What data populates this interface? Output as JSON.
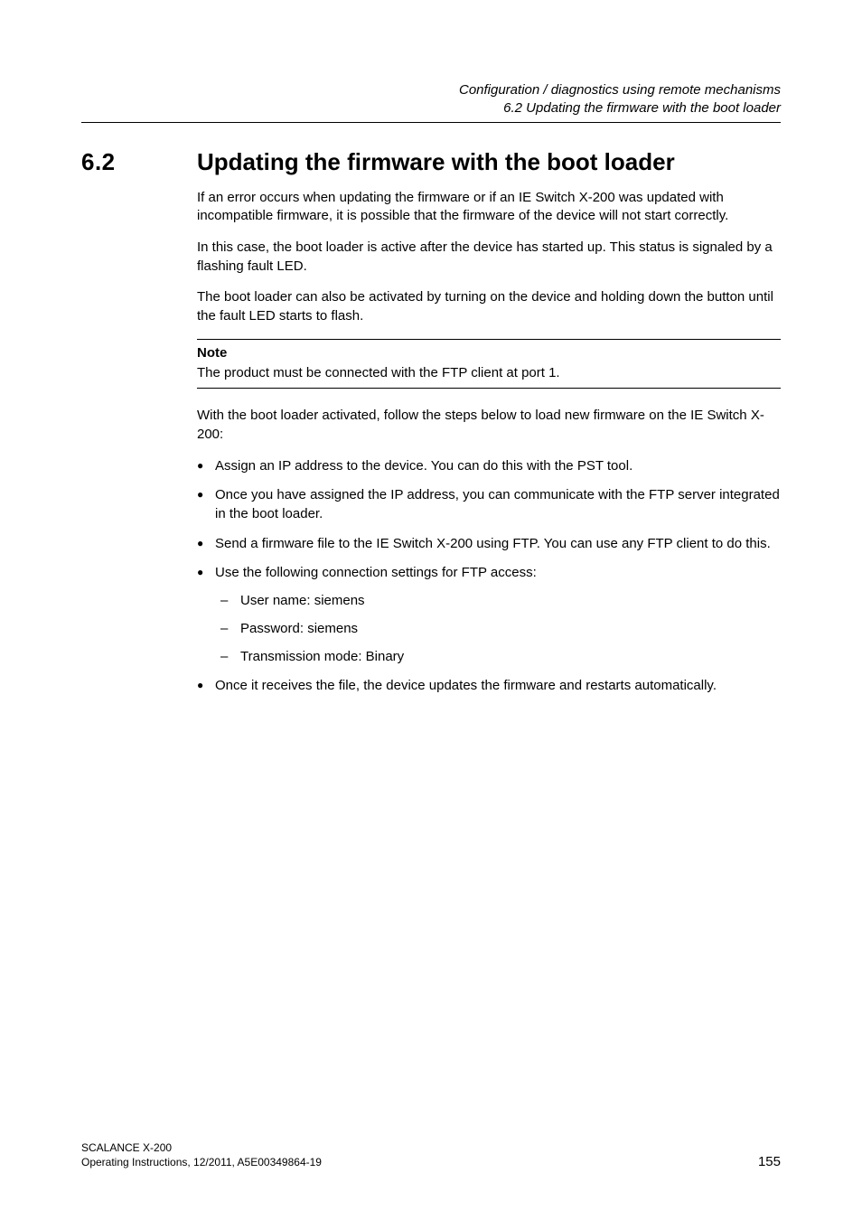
{
  "header": {
    "line1": "Configuration / diagnostics using remote mechanisms",
    "line2": "6.2 Updating the firmware with the boot loader"
  },
  "section": {
    "number": "6.2",
    "title": "Updating the firmware with the boot loader"
  },
  "paragraphs": {
    "p1": "If an error occurs when updating the firmware or if an IE Switch X-200 was updated with incompatible firmware, it is possible that the firmware of the device will not start correctly.",
    "p2": "In this case, the boot loader is active after the device has started up. This status is signaled by a flashing fault LED.",
    "p3": "The boot loader can also be activated by turning on the device and holding down the button until the fault LED starts to flash.",
    "p4": "With the boot loader activated, follow the steps below to load new firmware on the IE Switch X-200:"
  },
  "note": {
    "label": "Note",
    "text": "The product must be connected with the FTP client at port 1."
  },
  "bullets": {
    "b1": "Assign an IP address to the device. You can do this with the PST tool.",
    "b2": "Once you have assigned the IP address, you can communicate with the FTP server integrated in the boot loader.",
    "b3": "Send a firmware file to the IE Switch X-200 using FTP. You can use any FTP client to do this.",
    "b4": "Use the following connection settings for FTP access:",
    "b5": "Once it receives the file, the device updates the firmware and restarts automatically."
  },
  "sub": {
    "s1": "User name: siemens",
    "s2": "Password: siemens",
    "s3": "Transmission mode: Binary"
  },
  "footer": {
    "left_line1": "SCALANCE X-200",
    "left_line2": "Operating Instructions, 12/2011, A5E00349864-19",
    "page_number": "155"
  }
}
